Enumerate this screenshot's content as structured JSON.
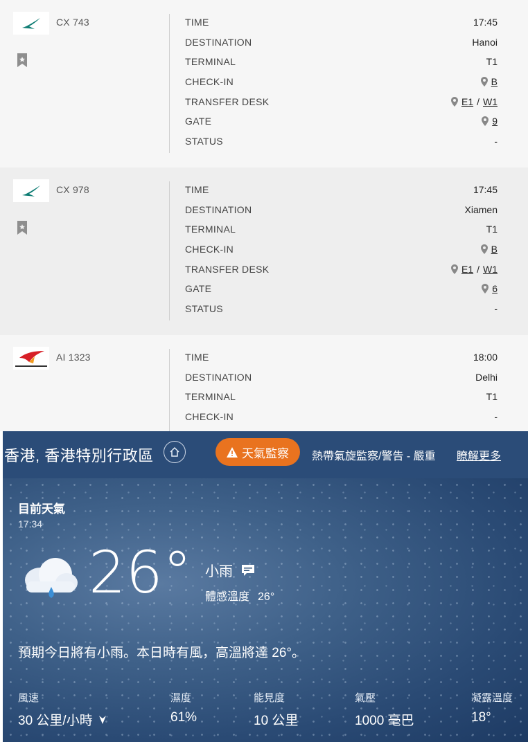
{
  "flights": [
    {
      "flight_no": "CX 743",
      "airline_icon": "cathay-pacific-logo",
      "rows": [
        {
          "label": "TIME",
          "value": "17:45"
        },
        {
          "label": "DESTINATION",
          "value": "Hanoi"
        },
        {
          "label": "TERMINAL",
          "value": "T1"
        },
        {
          "label": "CHECK-IN",
          "value": "B",
          "link": true
        },
        {
          "label": "TRANSFER DESK",
          "value": "E1",
          "value2": "W1",
          "link": true
        },
        {
          "label": "GATE",
          "value": "9",
          "link": true
        },
        {
          "label": "STATUS",
          "value": "-"
        }
      ]
    },
    {
      "flight_no": "CX 978",
      "airline_icon": "cathay-pacific-logo",
      "rows": [
        {
          "label": "TIME",
          "value": "17:45"
        },
        {
          "label": "DESTINATION",
          "value": "Xiamen"
        },
        {
          "label": "TERMINAL",
          "value": "T1"
        },
        {
          "label": "CHECK-IN",
          "value": "B",
          "link": true
        },
        {
          "label": "TRANSFER DESK",
          "value": "E1",
          "value2": "W1",
          "link": true
        },
        {
          "label": "GATE",
          "value": "6",
          "link": true
        },
        {
          "label": "STATUS",
          "value": "-"
        }
      ]
    },
    {
      "flight_no": "AI 1323",
      "airline_icon": "air-india-logo",
      "rows": [
        {
          "label": "TIME",
          "value": "18:00"
        },
        {
          "label": "DESTINATION",
          "value": "Delhi"
        },
        {
          "label": "TERMINAL",
          "value": "T1"
        },
        {
          "label": "CHECK-IN",
          "value": "-"
        }
      ]
    }
  ],
  "weather": {
    "location": "香港, 香港特別行政區",
    "alert_label": "天氣監察",
    "alert_text": "熱帶氣旋監察/警告 - 嚴重",
    "learn_more": "瞭解更多",
    "current_title": "目前天氣",
    "current_time": "17:34",
    "temperature": "26°",
    "condition": "小雨",
    "feels_label": "體感溫度",
    "feels_value": "26°",
    "forecast": "預期今日將有小雨。本日時有風，高溫將達 26°。",
    "stats": [
      {
        "label": "風速",
        "value": "30 公里/小時"
      },
      {
        "label": "濕度",
        "value": "61%"
      },
      {
        "label": "能見度",
        "value": "10 公里"
      },
      {
        "label": "氣壓",
        "value": "1000 毫巴"
      },
      {
        "label": "凝露溫度",
        "value": "18°"
      }
    ],
    "colors": {
      "alert": "#e9731f",
      "panel": "#2b4c78"
    }
  }
}
